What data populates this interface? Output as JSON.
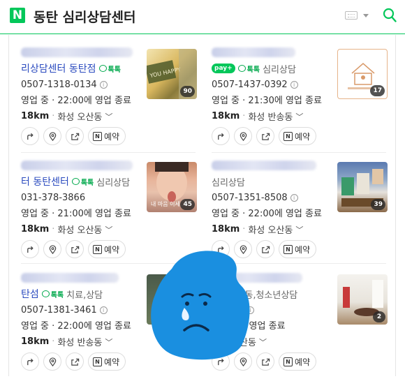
{
  "header": {
    "logo_text": "N",
    "query": "동탄 심리상담센터"
  },
  "listings": [
    {
      "name": "리상담센터 동탄점",
      "talk_label": "톡톡",
      "has_npay": false,
      "category": "",
      "phone": "0507-1318-0134",
      "hours": "영업 중 · 22:00에 영업 종료",
      "distance": "18km",
      "area": "화성 오산동",
      "photo_count": "90",
      "thumb_caption": "",
      "reserve_label": "예약"
    },
    {
      "name": "",
      "talk_label": "톡톡",
      "has_npay": true,
      "npay_label": "pay",
      "category": "심리상담",
      "phone": "0507-1437-0392",
      "hours": "영업 중 · 21:30에 영업 종료",
      "distance": "18km",
      "area": "화성 반송동",
      "photo_count": "17",
      "thumb_caption": "",
      "reserve_label": "예약"
    },
    {
      "name": "터 동탄센터",
      "talk_label": "톡톡",
      "has_npay": false,
      "category": "심리상담",
      "phone": "031-378-3866",
      "hours": "영업 중 · 21:00에 영업 종료",
      "distance": "18km",
      "area": "화성 오산동",
      "photo_count": "45",
      "thumb_caption": "내 마음 이세..",
      "reserve_label": "예약"
    },
    {
      "name": "",
      "talk_label": "",
      "has_npay": false,
      "category": "심리상담",
      "phone": "0507-1351-8508",
      "hours": "영업 중 · 22:00에 영업 종료",
      "distance": "18km",
      "area": "화성 오산동",
      "photo_count": "39",
      "thumb_caption": "",
      "reserve_label": "예약"
    },
    {
      "name": "탄섬",
      "talk_label": "톡톡",
      "has_npay": false,
      "category": "치료,상담",
      "phone": "0507-1381-3461",
      "hours": "영업 중 · 22:00에 영업 종료",
      "distance": "18km",
      "area": "화성 반송동",
      "photo_count": "",
      "thumb_caption": "",
      "reserve_label": "예약"
    },
    {
      "name": "",
      "talk_label": "톡톡",
      "has_npay": false,
      "category": "아동,청소년상담",
      "phone": "5-6545",
      "hours": "19:00에 영업 종료",
      "distance": "",
      "area": "화성 오산동",
      "photo_count": "2",
      "thumb_caption": "",
      "reserve_label": "예약"
    }
  ],
  "colors": {
    "brand": "#03c75a",
    "link": "#2b4bbf",
    "sticker": "#1a8fe0"
  },
  "icons": [
    "search-icon",
    "keyboard-icon",
    "directions-icon",
    "location-pin-icon",
    "share-icon",
    "naver-booking-icon",
    "info-icon",
    "chevron-down-icon"
  ]
}
